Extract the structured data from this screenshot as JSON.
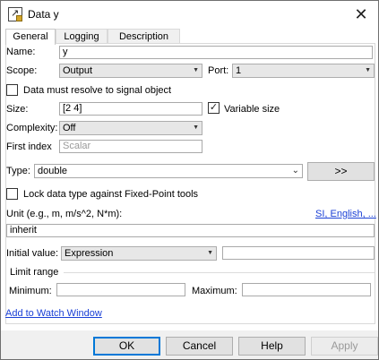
{
  "window": {
    "title": "Data y"
  },
  "tabs": [
    {
      "label": "General",
      "active": true
    },
    {
      "label": "Logging",
      "active": false
    },
    {
      "label": "Description",
      "active": false
    }
  ],
  "general": {
    "name_label": "Name:",
    "name_value": "y",
    "scope_label": "Scope:",
    "scope_value": "Output",
    "port_label": "Port:",
    "port_value": "1",
    "must_resolve_label": "Data must resolve to signal object",
    "must_resolve_checked": false,
    "size_label": "Size:",
    "size_value": "[2 4]",
    "variable_size_label": "Variable size",
    "variable_size_checked": true,
    "complexity_label": "Complexity:",
    "complexity_value": "Off",
    "first_index_label": "First index",
    "first_index_placeholder": "Scalar",
    "type_label": "Type:",
    "type_value": "double",
    "type_assistant_label": ">>",
    "lock_label": "Lock data type against Fixed-Point tools",
    "lock_checked": false,
    "unit_label": "Unit (e.g., m, m/s^2, N*m):",
    "unit_link": "SI, English, ...",
    "unit_value": "inherit",
    "initial_value_label": "Initial value:",
    "initial_value_mode": "Expression",
    "initial_value_value": "",
    "limit_range_label": "Limit range",
    "minimum_label": "Minimum:",
    "minimum_value": "",
    "maximum_label": "Maximum:",
    "maximum_value": "",
    "watch_link": "Add to Watch Window"
  },
  "buttons": {
    "ok": "OK",
    "cancel": "Cancel",
    "help": "Help",
    "apply": "Apply"
  },
  "icons": {
    "app": "simulink-data-icon",
    "close": "close-icon",
    "dropdown": "chevron-down-icon",
    "check": "checkmark-icon"
  },
  "colors": {
    "link": "#1a3fd6",
    "primary_border": "#0078d7",
    "lock_badge": "#d4a62a"
  }
}
